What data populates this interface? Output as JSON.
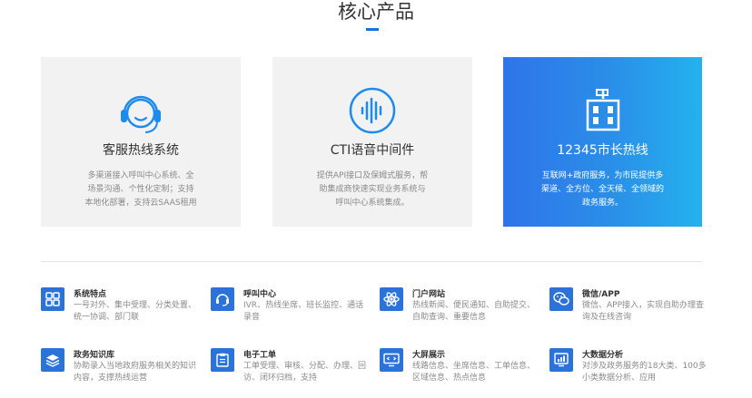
{
  "section": {
    "title": "核心产品"
  },
  "cards": [
    {
      "title": "客服热线系统",
      "desc": "多渠道接入呼叫中心系统、全场景沟通、个性化定制；支持本地化部署，支持云SAAS租用",
      "icon": "headset-icon"
    },
    {
      "title": "CTI语音中间件",
      "desc": "提供API接口及保姆式服务，帮助集成商快速实现业务系统与呼叫中心系统集成。",
      "icon": "soundwave-icon"
    },
    {
      "title": "12345市长热线",
      "desc": "互联网+政府服务，为市民提供多渠道、全方位、全天候、全领域的政务服务。",
      "icon": "building-icon"
    }
  ],
  "features": [
    {
      "title": "系统特点",
      "desc": "一号对外、集中受理、分类处置、统一协调、部门联",
      "icon": "grid-icon"
    },
    {
      "title": "呼叫中心",
      "desc": "IVR、热线坐席、班长监控、通话录音",
      "icon": "headset-icon"
    },
    {
      "title": "门户网站",
      "desc": "热线新闻、便民通知、自助提交、自助查询、重要信息",
      "icon": "atom-icon"
    },
    {
      "title": "微信/APP",
      "desc": "微信、APP接入，实现自助办理查询及在线咨询",
      "icon": "wechat-icon"
    },
    {
      "title": "政务知识库",
      "desc": "协助录入当地政府服务相关的知识内容，支撑热线运营",
      "icon": "layers-icon"
    },
    {
      "title": "电子工单",
      "desc": "工单受理、审核、分配、办理、回访、闭环归档，支持",
      "icon": "clipboard-icon"
    },
    {
      "title": "大屏展示",
      "desc": "线路信息、坐席信息、工单信息、区域信息、热点信息",
      "icon": "monitor-icon"
    },
    {
      "title": "大数据分析",
      "desc": "对涉及政务服务的18大类、100多小类数据分析、应用",
      "icon": "analytics-icon"
    }
  ],
  "colors": {
    "accent": "#1673dd",
    "card_bg": "#f2f2f2",
    "icon_bg": "#2b73d8",
    "highlight_start": "#2f74ea",
    "highlight_end": "#24b1ef"
  }
}
